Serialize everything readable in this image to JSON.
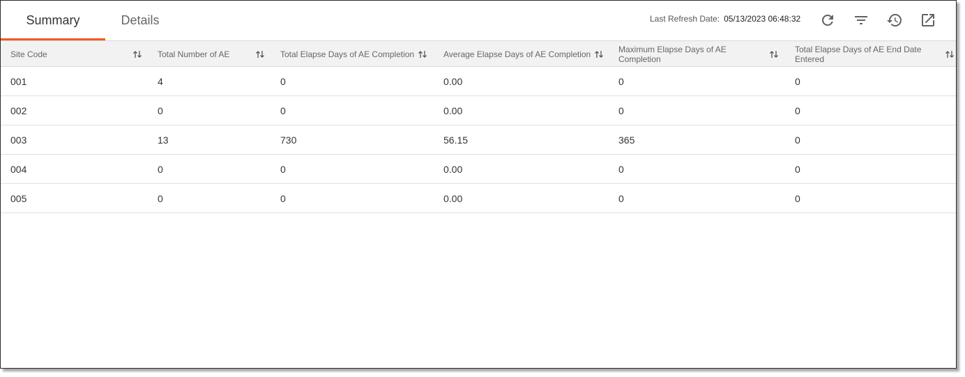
{
  "tabs": [
    {
      "label": "Summary",
      "active": true
    },
    {
      "label": "Details",
      "active": false
    }
  ],
  "refresh": {
    "label": "Last Refresh Date:",
    "value": "05/13/2023 06:48:32"
  },
  "toolbar_icons": [
    "refresh-icon",
    "filter-icon",
    "history-icon",
    "open-external-icon"
  ],
  "colors": {
    "accent": "#f05a22",
    "header_bg": "#f2f2f2",
    "icon": "#5f6368"
  },
  "table": {
    "headers": [
      "Site Code",
      "Total Number of AE",
      "Total Elapse Days of AE Completion",
      "Average Elapse Days of AE Completion",
      "Maximum Elapse Days of AE Completion",
      "Total Elapse Days of AE End Date Entered"
    ],
    "rows": [
      [
        "001",
        "4",
        "0",
        "0.00",
        "0",
        "0"
      ],
      [
        "002",
        "0",
        "0",
        "0.00",
        "0",
        "0"
      ],
      [
        "003",
        "13",
        "730",
        "56.15",
        "365",
        "0"
      ],
      [
        "004",
        "0",
        "0",
        "0.00",
        "0",
        "0"
      ],
      [
        "005",
        "0",
        "0",
        "0.00",
        "0",
        "0"
      ]
    ]
  }
}
